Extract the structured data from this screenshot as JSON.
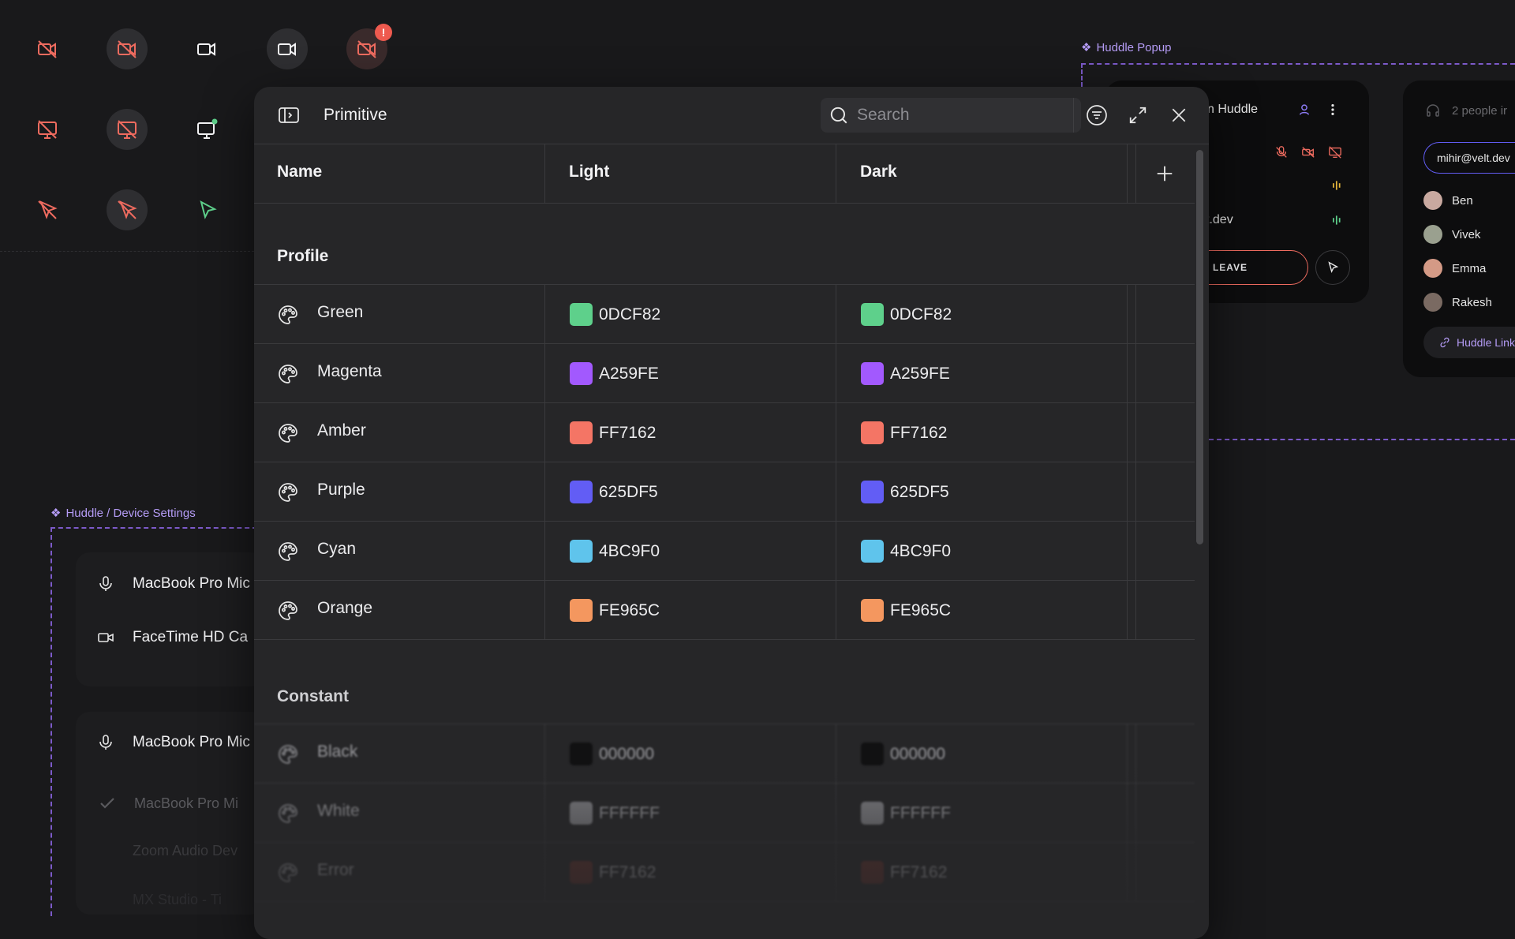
{
  "background": {
    "frames": {
      "popup_tag": "Huddle Popup",
      "device_tag": "Huddle / Device Settings"
    },
    "icon_grid": {
      "row1": [
        "video-off-icon",
        "video-off-icon",
        "video-icon",
        "video-icon",
        "video-off-alert-icon"
      ],
      "row2": [
        "screen-off-icon",
        "screen-off-icon",
        "screen-share-active-icon"
      ],
      "row3": [
        "pointer-off-icon",
        "pointer-off-icon",
        "pointer-icon"
      ],
      "alert_badge": "!"
    },
    "huddle_card": {
      "title_fragment": "n Huddle",
      "email_fragment": "t.dev",
      "leave_label": "LEAVE"
    },
    "participants_card": {
      "count_text": "2 people ir",
      "email_value": "mihir@velt.dev",
      "people": [
        "Ben",
        "Vivek",
        "Emma",
        "Rakesh"
      ],
      "link_label": "Huddle Link"
    },
    "device_settings": {
      "mic_label": "MacBook Pro Mic",
      "camera_label": "FaceTime HD Ca",
      "dropdown_label": "MacBook Pro Mic",
      "options": [
        "MacBook Pro Mi",
        "Zoom Audio Dev",
        "MX Studio - Ti"
      ]
    }
  },
  "panel": {
    "title": "Primitive",
    "search_placeholder": "Search",
    "columns": [
      "Name",
      "Light",
      "Dark"
    ],
    "sections": [
      {
        "title": "Profile",
        "rows": [
          {
            "name": "Green",
            "light": "0DCF82",
            "dark": "0DCF82",
            "light_color": "#5ed08b",
            "dark_color": "#5ed08b"
          },
          {
            "name": "Magenta",
            "light": "A259FE",
            "dark": "A259FE",
            "light_color": "#a259fe",
            "dark_color": "#a259fe"
          },
          {
            "name": "Amber",
            "light": "FF7162",
            "dark": "FF7162",
            "light_color": "#f47565",
            "dark_color": "#f47565"
          },
          {
            "name": "Purple",
            "light": "625DF5",
            "dark": "625DF5",
            "light_color": "#625df5",
            "dark_color": "#625df5"
          },
          {
            "name": "Cyan",
            "light": "4BC9F0",
            "dark": "4BC9F0",
            "light_color": "#5fc4ec",
            "dark_color": "#5fc4ec"
          },
          {
            "name": "Orange",
            "light": "FE965C",
            "dark": "FE965C",
            "light_color": "#f4975f",
            "dark_color": "#f4975f"
          }
        ]
      },
      {
        "title": "Constant",
        "rows": [
          {
            "name": "Black",
            "light": "000000",
            "dark": "000000",
            "light_color": "#111112",
            "dark_color": "#111112"
          },
          {
            "name": "White",
            "light": "FFFFFF",
            "dark": "FFFFFF",
            "light_color": "#7c7c80",
            "dark_color": "#7c7c80"
          },
          {
            "name": "Error",
            "light": "FF7162",
            "dark": "FF7162",
            "light_color": "#5a2f2b",
            "dark_color": "#5a2f2b"
          }
        ]
      }
    ]
  }
}
